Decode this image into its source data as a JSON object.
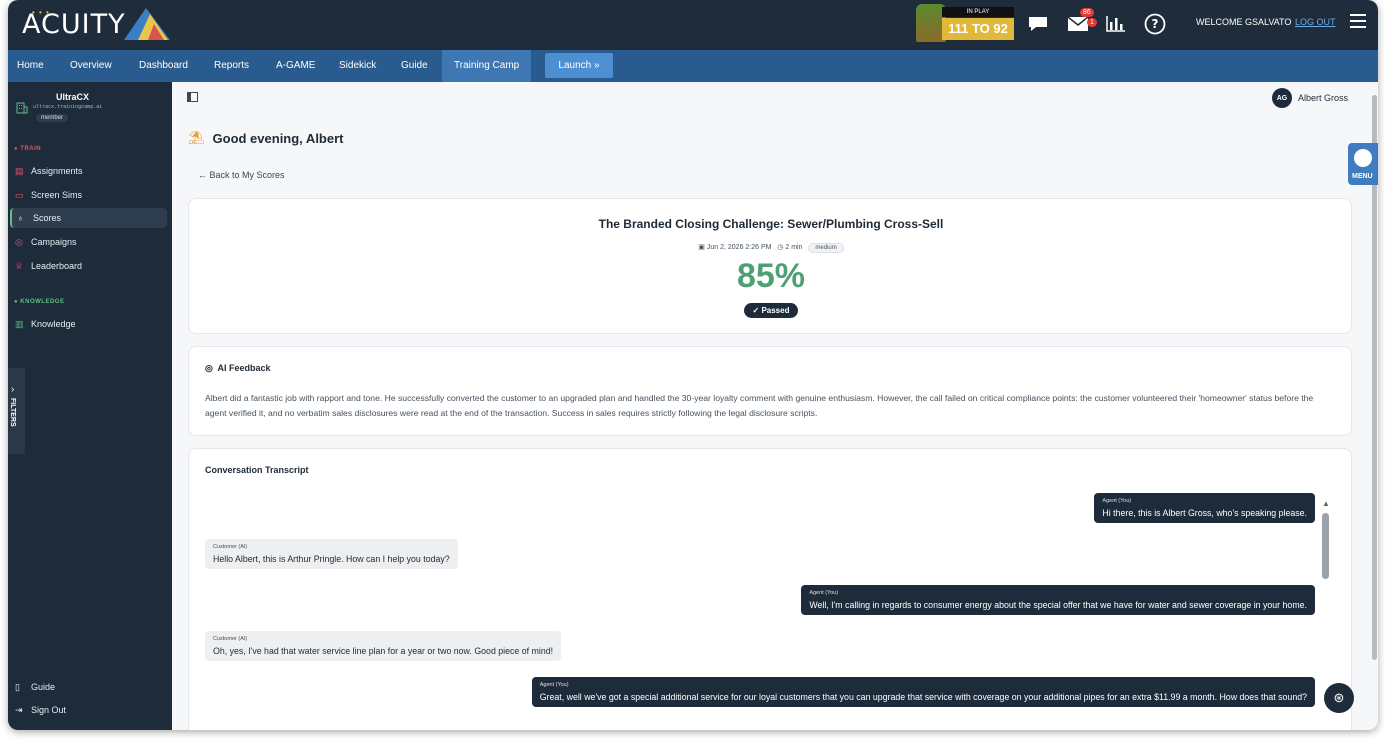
{
  "header": {
    "logo_text": "ACUITY",
    "in_play_label": "IN PLAY",
    "in_play_score": "111 TO 92",
    "mail_badge": "86",
    "mail_sub_badge": "1",
    "welcome": "WELCOME GSALVATO",
    "logout": "LOG OUT"
  },
  "nav": {
    "items": [
      "Home",
      "Overview",
      "Dashboard",
      "Reports",
      "A-GAME",
      "Sidekick",
      "Guide",
      "Training Camp"
    ],
    "active": "Training Camp",
    "launch": "Launch »"
  },
  "sidebar": {
    "org_name": "UltraCX",
    "org_url": "ultracx.trainingcamp.ai",
    "org_role": "member",
    "train_label": "TRAIN",
    "train_items": [
      "Assignments",
      "Screen Sims",
      "Scores",
      "Campaigns",
      "Leaderboard"
    ],
    "active_item": "Scores",
    "knowledge_label": "KNOWLEDGE",
    "knowledge_items": [
      "Knowledge"
    ],
    "bottom_items": [
      "Guide",
      "Sign Out"
    ],
    "filters_tab": "FILTERS"
  },
  "main": {
    "user_initials": "AG",
    "user_name": "Albert Gross",
    "greeting": "Good evening, Albert",
    "back_link": "Back to My Scores",
    "score": {
      "title": "The Branded Closing Challenge: Sewer/Plumbing Cross-Sell",
      "date": "Jun 2, 2026 2:26 PM",
      "duration": "2 min",
      "difficulty": "medium",
      "percent": "85%",
      "status": "✓ Passed"
    },
    "feedback": {
      "heading": "AI Feedback",
      "text": "Albert did a fantastic job with rapport and tone. He successfully converted the customer to an upgraded plan and handled the 30-year loyalty comment with genuine enthusiasm. However, the call failed on critical compliance points: the customer volunteered their 'homeowner' status before the agent verified it, and no verbatim sales disclosures were read at the end of the transaction. Success in sales requires strictly following the legal disclosure scripts."
    },
    "transcript": {
      "heading": "Conversation Transcript",
      "messages": [
        {
          "role": "agent",
          "who": "Agent (You)",
          "text": "Hi there, this is Albert Gross, who's speaking please."
        },
        {
          "role": "cust",
          "who": "Customer (AI)",
          "text": "Hello Albert, this is Arthur Pringle. How can I help you today?"
        },
        {
          "role": "agent",
          "who": "Agent (You)",
          "text": "Well, I'm calling in regards to consumer energy about the special offer that we have for water and sewer coverage in your home."
        },
        {
          "role": "cust",
          "who": "Customer (AI)",
          "text": "Oh, yes, I've had that water service line plan for a year or two now. Good piece of mind!"
        },
        {
          "role": "agent",
          "who": "Agent (You)",
          "text": "Great, well we've got a special additional service for our loyal customers that you can upgrade that service with coverage on your additional pipes for an extra $11.99 a month. How does that sound?"
        }
      ]
    },
    "game_menu_label": "MENU"
  }
}
